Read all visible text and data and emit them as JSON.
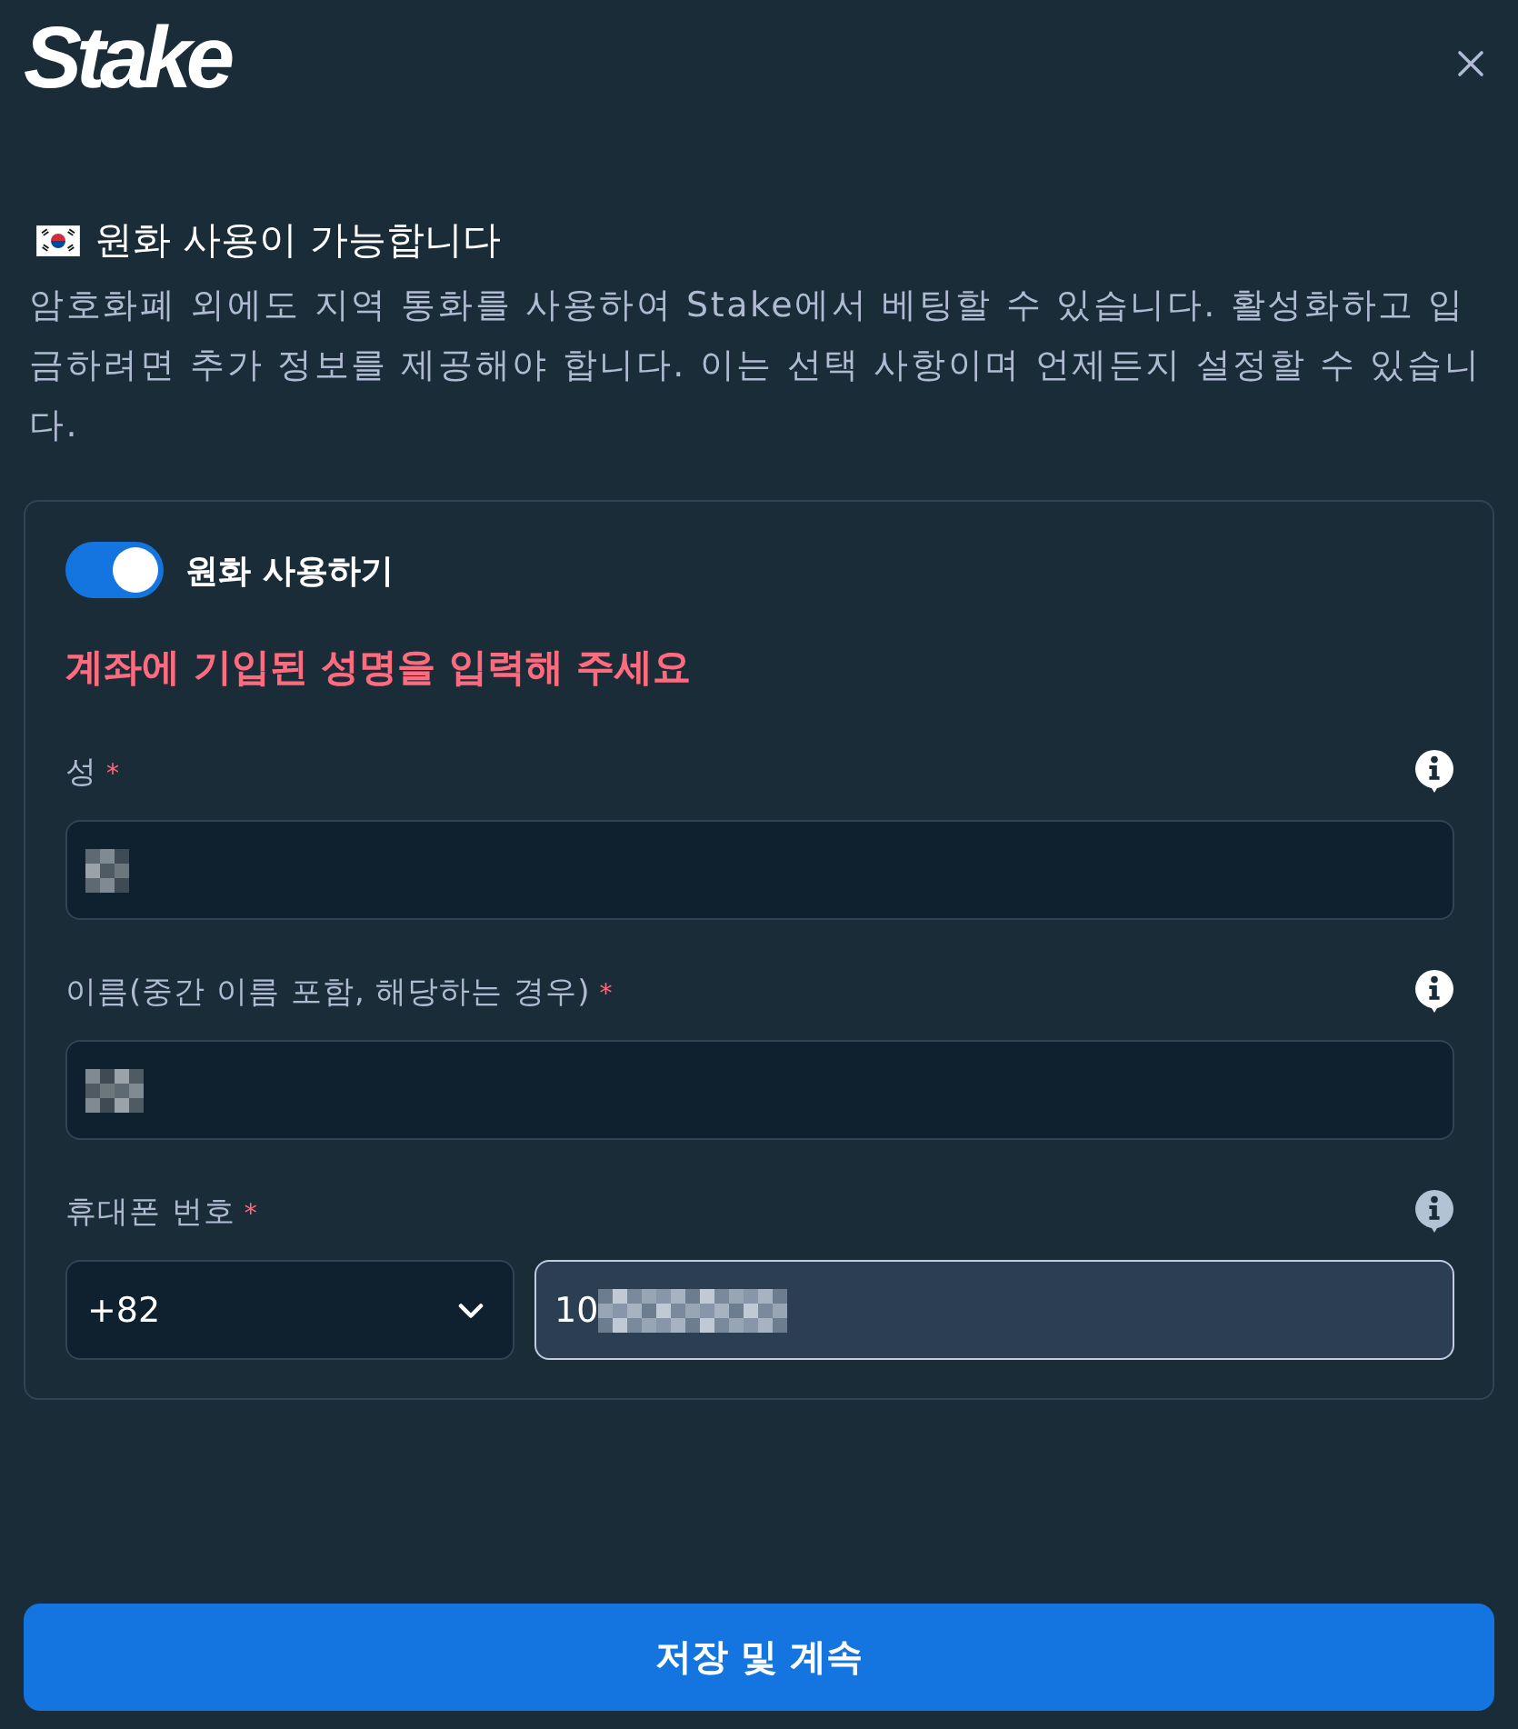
{
  "header": {
    "logo": "Stake"
  },
  "notice": {
    "title": "원화 사용이 가능합니다",
    "description": "암호화폐 외에도 지역 통화를 사용하여 Stake에서 베팅할 수 있습니다. 활성화하고 입금하려면 추가 정보를 제공해야 합니다. 이는 선택 사항이며 언제든지 설정할 수 있습니다."
  },
  "form": {
    "toggle": {
      "label": "원화 사용하기",
      "on": true
    },
    "error": "계좌에 기입된 성명을 입력해 주세요",
    "fields": [
      {
        "kind": "text",
        "label": "성",
        "required_mark": "*",
        "info_bright": true,
        "redacted": true,
        "focused": false
      },
      {
        "kind": "text",
        "label": "이름(중간 이름 포함, 해당하는 경우)",
        "required_mark": "*",
        "info_bright": true,
        "redacted": true,
        "focused": false
      },
      {
        "kind": "phone",
        "label": "휴대폰 번호",
        "required_mark": "*",
        "info_bright": false,
        "country_code": "+82",
        "value": "10",
        "redacted": true,
        "focused": true
      }
    ]
  },
  "save_button": "저장 및 계속"
}
